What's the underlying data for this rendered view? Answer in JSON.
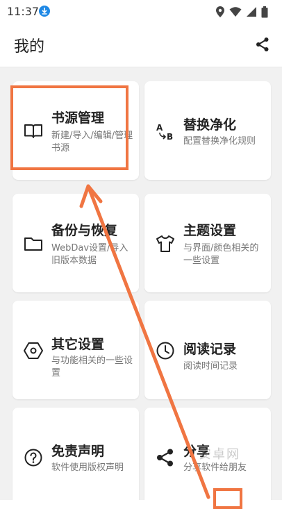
{
  "status_bar": {
    "time": "11:37"
  },
  "app_bar": {
    "title": "我的"
  },
  "cards": [
    {
      "title": "书源管理",
      "subtitle": "新建/导入/编辑/管理书源",
      "icon": "book-icon"
    },
    {
      "title": "替换净化",
      "subtitle": "配置替换净化规则",
      "icon": "a-to-b-replace-icon"
    },
    {
      "title": "备份与恢复",
      "subtitle": "WebDav设置/导入旧版本数据",
      "icon": "folder-icon"
    },
    {
      "title": "主题设置",
      "subtitle": "与界面/颜色相关的一些设置",
      "icon": "shirt-icon"
    },
    {
      "title": "其它设置",
      "subtitle": "与功能相关的一些设置",
      "icon": "hexagon-settings-icon"
    },
    {
      "title": "阅读记录",
      "subtitle": "阅读时间记录",
      "icon": "clock-icon"
    },
    {
      "title": "免责声明",
      "subtitle": "软件使用版权声明",
      "icon": "help-circle-icon"
    },
    {
      "title": "分享",
      "subtitle": "分享软件给朋友",
      "icon": "share-icon"
    }
  ],
  "watermark": "安卓网",
  "colors": {
    "annotation": "#f07542",
    "background": "#f1f1f1",
    "card": "#ffffff"
  }
}
